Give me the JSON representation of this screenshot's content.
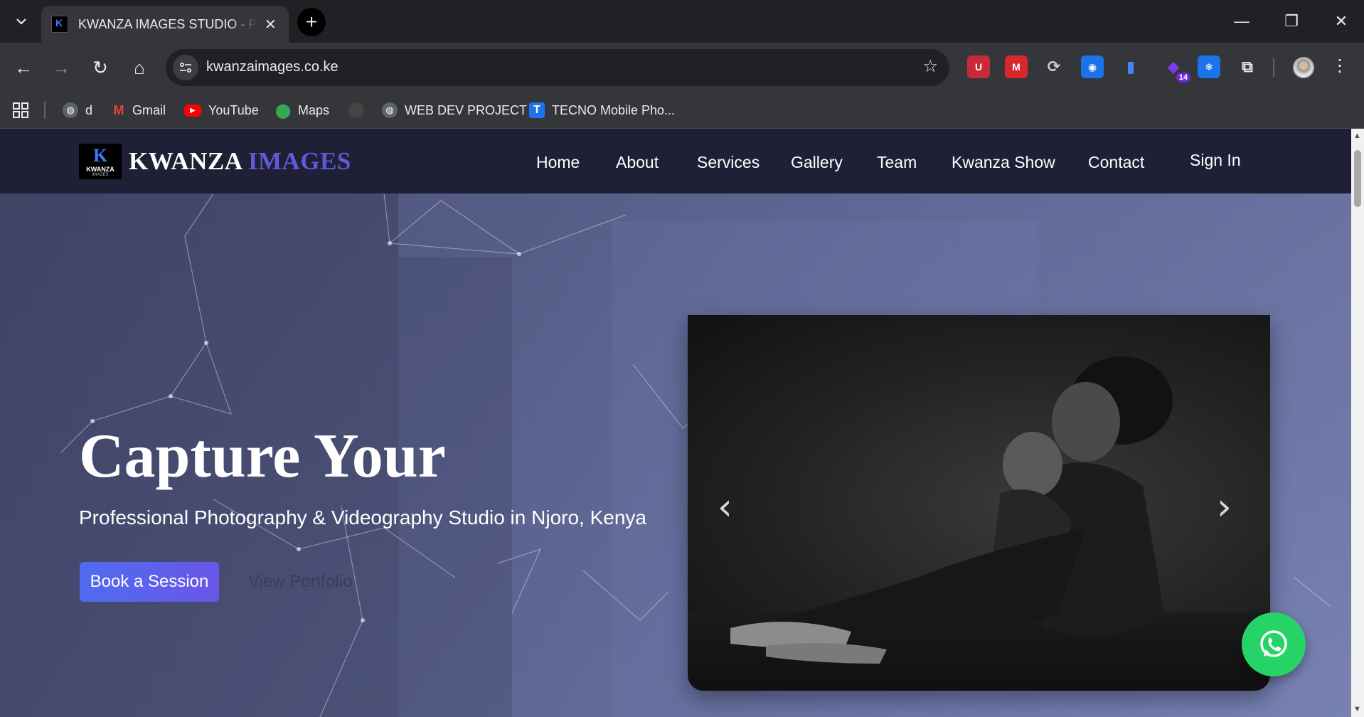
{
  "browser": {
    "tab": {
      "title": "KWANZA IMAGES STUDIO - Pre",
      "close": "✕"
    },
    "new_tab": "+",
    "window_controls": {
      "minimize": "—",
      "restore": "❐",
      "close": "✕"
    },
    "nav": {
      "back": "←",
      "forward": "→",
      "reload": "↻",
      "home": "⌂"
    },
    "address": {
      "url": "kwanzaimages.co.ke",
      "site_info_icon": "tune-icon",
      "bookmark_icon": "star-icon"
    },
    "extensions": [
      {
        "name": "ublock-icon",
        "glyph": "U",
        "color": "#c62a3b"
      },
      {
        "name": "mendeley-icon",
        "glyph": "M",
        "color": "#d9272e"
      },
      {
        "name": "sync-icon",
        "glyph": "⟳",
        "color": "#5f6368"
      },
      {
        "name": "screen-capture-icon",
        "glyph": "◉",
        "color": "#1a73e8"
      },
      {
        "name": "clipboard-icon",
        "glyph": "▮",
        "color": "#4285f4"
      },
      {
        "name": "notification-extension-icon",
        "glyph": "◆",
        "color": "#6d28d9",
        "badge": "14"
      },
      {
        "name": "snowflake-icon",
        "glyph": "❄",
        "color": "#1a73e8"
      },
      {
        "name": "puzzle-icon",
        "glyph": "⧉",
        "color": "#5f6368"
      }
    ],
    "menu": "⋮",
    "bookmarks": [
      {
        "label": "",
        "icon": "apps-grid-icon"
      },
      {
        "label": "d",
        "icon": "globe-icon",
        "color": "#5f6368"
      },
      {
        "label": "Gmail",
        "icon": "gmail-icon",
        "color": "#ea4335"
      },
      {
        "label": "YouTube",
        "icon": "youtube-icon",
        "color": "#ff0000"
      },
      {
        "label": "Maps",
        "icon": "maps-icon",
        "color": "#34a853"
      },
      {
        "label": "",
        "icon": "chrome-icon",
        "color": "#444"
      },
      {
        "label": "WEB DEV PROJECT",
        "icon": "globe-icon",
        "color": "#5f6368"
      },
      {
        "label": "TECNO Mobile Pho...",
        "icon": "tecno-icon",
        "color": "#1a73e8"
      }
    ]
  },
  "site": {
    "logo": {
      "mark": "K",
      "line1": "KWANZA",
      "line2": "IMAGES"
    },
    "brand": {
      "part1": "KWANZA ",
      "part2": "IMAGES"
    },
    "nav": [
      "Home",
      "About",
      "Services",
      "Gallery",
      "Team",
      "Kwanza Show",
      "Contact"
    ],
    "sign_in": "Sign In",
    "hero": {
      "title": "Capture Your",
      "subtitle": "Professional Photography & Videography Studio in Njoro, Kenya",
      "primary_button": "Book a Session",
      "secondary_button": "View Portfolio"
    },
    "carousel": {
      "prev": "‹",
      "next": "›"
    },
    "whatsapp_icon": "whatsapp-icon"
  },
  "colors": {
    "nav_bg": "#1f1f36",
    "brand_accent": "#5b5bd6",
    "button_start": "#4f6cf0",
    "button_end": "#6a56e8",
    "whatsapp": "#25d366"
  }
}
